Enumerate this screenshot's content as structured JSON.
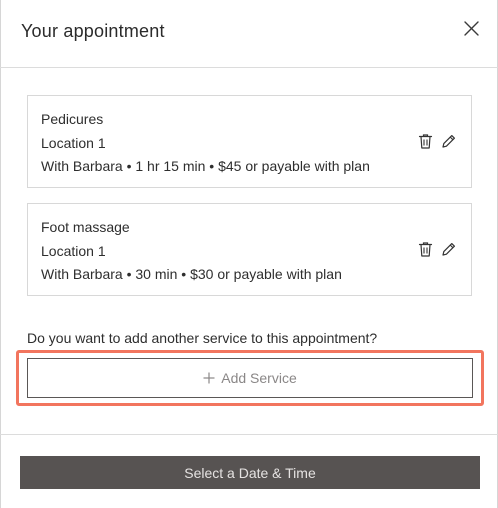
{
  "dialog": {
    "title": "Your appointment",
    "close_icon": "close-icon"
  },
  "services": [
    {
      "name": "Pedicures",
      "location": "Location 1",
      "details": "With Barbara • 1 hr 15 min • $45 or payable with plan",
      "delete_icon": "trash-icon",
      "edit_icon": "pencil-icon"
    },
    {
      "name": "Foot massage",
      "location": "Location 1",
      "details": "With Barbara • 30 min • $30 or payable with plan",
      "delete_icon": "trash-icon",
      "edit_icon": "pencil-icon"
    }
  ],
  "add_service": {
    "question": "Do you want to add another service to this appointment?",
    "button_label": "Add Service",
    "icon": "plus-icon",
    "highlight_color": "#f2755e"
  },
  "footer": {
    "primary_button_label": "Select a Date & Time",
    "primary_button_color": "#575352"
  }
}
